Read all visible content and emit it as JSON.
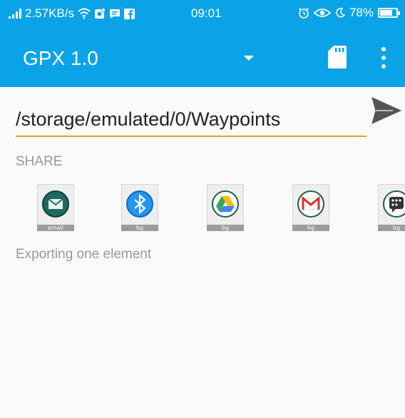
{
  "status_bar": {
    "network_speed": "2.57KB/s",
    "time": "09:01",
    "battery_percent": "78%",
    "battery_level": 0.78,
    "icons": [
      "signal-icon",
      "wifi-icon",
      "app-notification-icon",
      "message-icon",
      "facebook-icon",
      "alarm-icon",
      "eye-comfort-icon",
      "night-mode-icon",
      "battery-icon"
    ]
  },
  "app_bar": {
    "title": "GPX 1.0",
    "background_color": "#0aa3e8",
    "icons": [
      "dropdown-arrow-icon",
      "sd-card-icon",
      "overflow-menu-icon"
    ]
  },
  "path": {
    "value": "/storage/emulated/0/Waypoints",
    "underline_color": "#e8a030"
  },
  "share": {
    "label": "SHARE",
    "targets": [
      {
        "name": "email",
        "caption": "email",
        "icon": "email-icon",
        "color": "#1d6b5e"
      },
      {
        "name": "bluetooth",
        "caption": "bg",
        "icon": "bluetooth-icon",
        "color": "#2196f3"
      },
      {
        "name": "drive",
        "caption": "bg",
        "icon": "google-drive-icon",
        "color": "#1e8e3e"
      },
      {
        "name": "gmail",
        "caption": "bg",
        "icon": "gmail-icon",
        "color": "#d93025"
      },
      {
        "name": "blackberry",
        "caption": "bg",
        "icon": "blackberry-messenger-icon",
        "color": "#333333"
      }
    ]
  },
  "status_message": "Exporting one element"
}
